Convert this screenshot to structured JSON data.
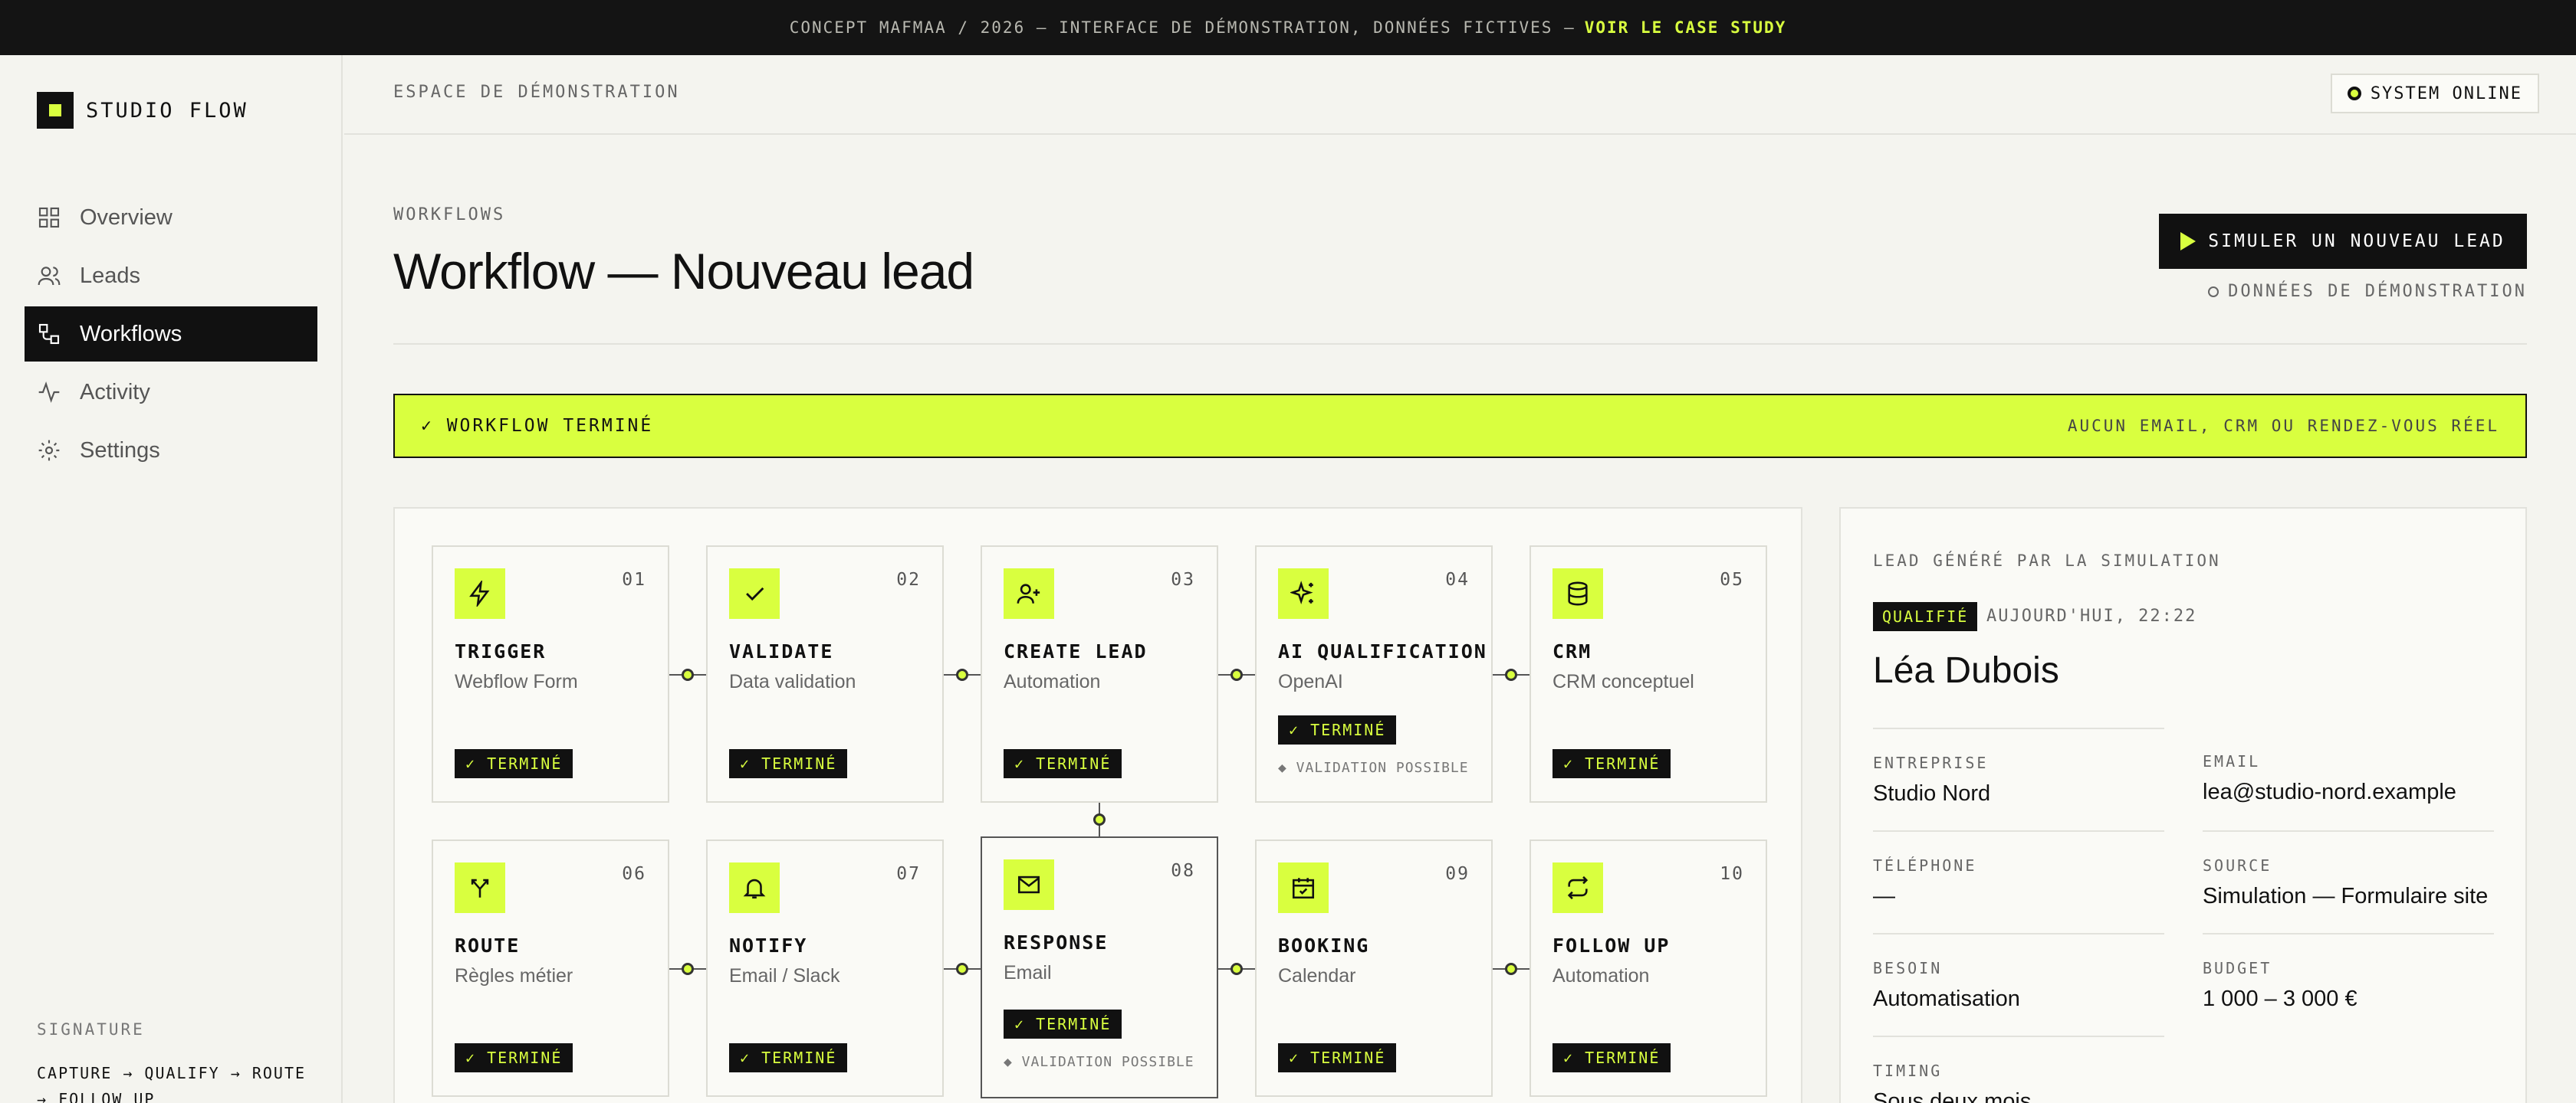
{
  "banner": {
    "text": "CONCEPT MAFMAA / 2026 — INTERFACE DE DÉMONSTRATION, DONNÉES FICTIVES —",
    "cta": "VOIR LE CASE STUDY"
  },
  "brand": {
    "name": "STUDIO FLOW"
  },
  "sidebar": {
    "items": [
      {
        "label": "Overview",
        "icon": "grid-icon",
        "active": false
      },
      {
        "label": "Leads",
        "icon": "users-icon",
        "active": false
      },
      {
        "label": "Workflows",
        "icon": "workflow-icon",
        "active": true
      },
      {
        "label": "Activity",
        "icon": "activity-icon",
        "active": false
      },
      {
        "label": "Settings",
        "icon": "gear-icon",
        "active": false
      }
    ],
    "signature_label": "SIGNATURE",
    "signature_text": "CAPTURE → QUALIFY → ROUTE → FOLLOW UP"
  },
  "header": {
    "breadcrumb": "ESPACE DE DÉMONSTRATION",
    "status": "SYSTEM ONLINE"
  },
  "page": {
    "eyebrow": "WORKFLOWS",
    "title": "Workflow — Nouveau lead",
    "simulate_button": "SIMULER UN NOUVEAU LEAD",
    "demo_note": "DONNÉES DE DÉMONSTRATION"
  },
  "done_bar": {
    "left": "✓ WORKFLOW TERMINÉ",
    "right": "AUCUN EMAIL, CRM OU RENDEZ-VOUS RÉEL"
  },
  "workflow": {
    "nodes": [
      {
        "num": "01",
        "title": "TRIGGER",
        "sub": "Webflow Form",
        "badge": "✓ TERMINÉ",
        "icon": "bolt-icon"
      },
      {
        "num": "02",
        "title": "VALIDATE",
        "sub": "Data validation",
        "badge": "✓ TERMINÉ",
        "icon": "check-icon"
      },
      {
        "num": "03",
        "title": "CREATE LEAD",
        "sub": "Automation",
        "badge": "✓ TERMINÉ",
        "icon": "user-plus-icon"
      },
      {
        "num": "04",
        "title": "AI QUALIFICATION",
        "sub": "OpenAI",
        "badge": "✓ TERMINÉ",
        "note": "◆ VALIDATION POSSIBLE",
        "icon": "sparkles-icon"
      },
      {
        "num": "05",
        "title": "CRM",
        "sub": "CRM conceptuel",
        "badge": "✓ TERMINÉ",
        "icon": "database-icon"
      },
      {
        "num": "06",
        "title": "ROUTE",
        "sub": "Règles métier",
        "badge": "✓ TERMINÉ",
        "icon": "split-icon"
      },
      {
        "num": "07",
        "title": "NOTIFY",
        "sub": "Email / Slack",
        "badge": "✓ TERMINÉ",
        "icon": "bell-icon"
      },
      {
        "num": "08",
        "title": "RESPONSE",
        "sub": "Email",
        "badge": "✓ TERMINÉ",
        "note": "◆ VALIDATION POSSIBLE",
        "icon": "mail-icon"
      },
      {
        "num": "09",
        "title": "BOOKING",
        "sub": "Calendar",
        "badge": "✓ TERMINÉ",
        "icon": "calendar-check-icon"
      },
      {
        "num": "10",
        "title": "FOLLOW UP",
        "sub": "Automation",
        "badge": "✓ TERMINÉ",
        "icon": "repeat-icon"
      }
    ]
  },
  "lead": {
    "label": "LEAD GÉNÉRÉ PAR LA SIMULATION",
    "badge": "QUALIFIÉ",
    "time": "AUJOURD'HUI, 22:22",
    "name": "Léa Dubois",
    "fields": [
      {
        "k": "ENTREPRISE",
        "v": "Studio Nord"
      },
      {
        "k": "EMAIL",
        "v": "lea@studio-nord.example"
      },
      {
        "k": "TÉLÉPHONE",
        "v": "—"
      },
      {
        "k": "SOURCE",
        "v": "Simulation — Formulaire site"
      },
      {
        "k": "BESOIN",
        "v": "Automatisation"
      },
      {
        "k": "BUDGET",
        "v": "1 000 – 3 000 €"
      },
      {
        "k": "TIMING",
        "v": "Sous deux mois"
      }
    ]
  },
  "colors": {
    "accent": "#d9ff3f",
    "ink": "#111111",
    "background": "#f4f4ef"
  }
}
